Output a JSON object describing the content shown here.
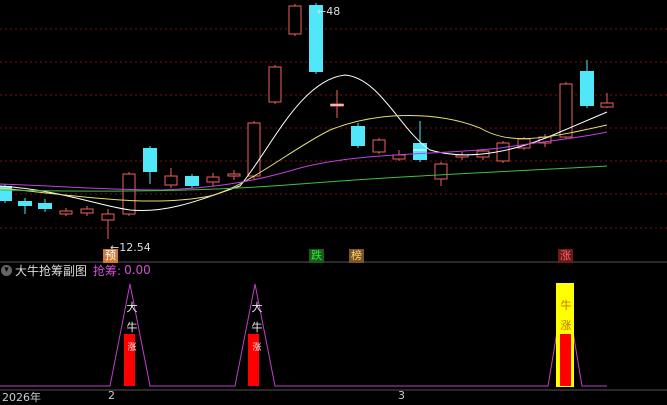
{
  "main_chart": {
    "price_high_label": "48",
    "price_low_label": "12.54",
    "signals": [
      {
        "text": "预",
        "bg": "#d07a36",
        "color": "#fff"
      },
      {
        "text": "跌",
        "bg": "#1a5a1a",
        "color": "#2ee82e"
      },
      {
        "text": "榜",
        "bg": "#7a5520",
        "color": "#ffd27a"
      },
      {
        "text": "涨",
        "bg": "#6a1a1a",
        "color": "#ff6060"
      }
    ]
  },
  "sub_chart": {
    "expand_icon": "chevron-down-icon",
    "title": "大牛抢筹副图",
    "indicator_label": "抢筹:",
    "indicator_value": "0.00",
    "peak_labels": [
      {
        "top": "大",
        "mid": "牛",
        "bottom": "涨"
      },
      {
        "top": "大",
        "mid": "牛",
        "bottom": "涨"
      },
      {
        "top": "牛",
        "mid": "涨",
        "bottom": ""
      }
    ]
  },
  "x_axis": {
    "labels": [
      "2026年",
      "2",
      "3"
    ]
  },
  "colors": {
    "up": "#f06060",
    "down": "#50e8f8",
    "ma_white": "#ffffff",
    "ma_yellow": "#e0e070",
    "ma_purple": "#c040e0",
    "ma_green": "#40c040",
    "sub_line": "#c040c8",
    "sub_bar_red": "#ff0000",
    "sub_bar_yellow": "#ffff00"
  }
}
